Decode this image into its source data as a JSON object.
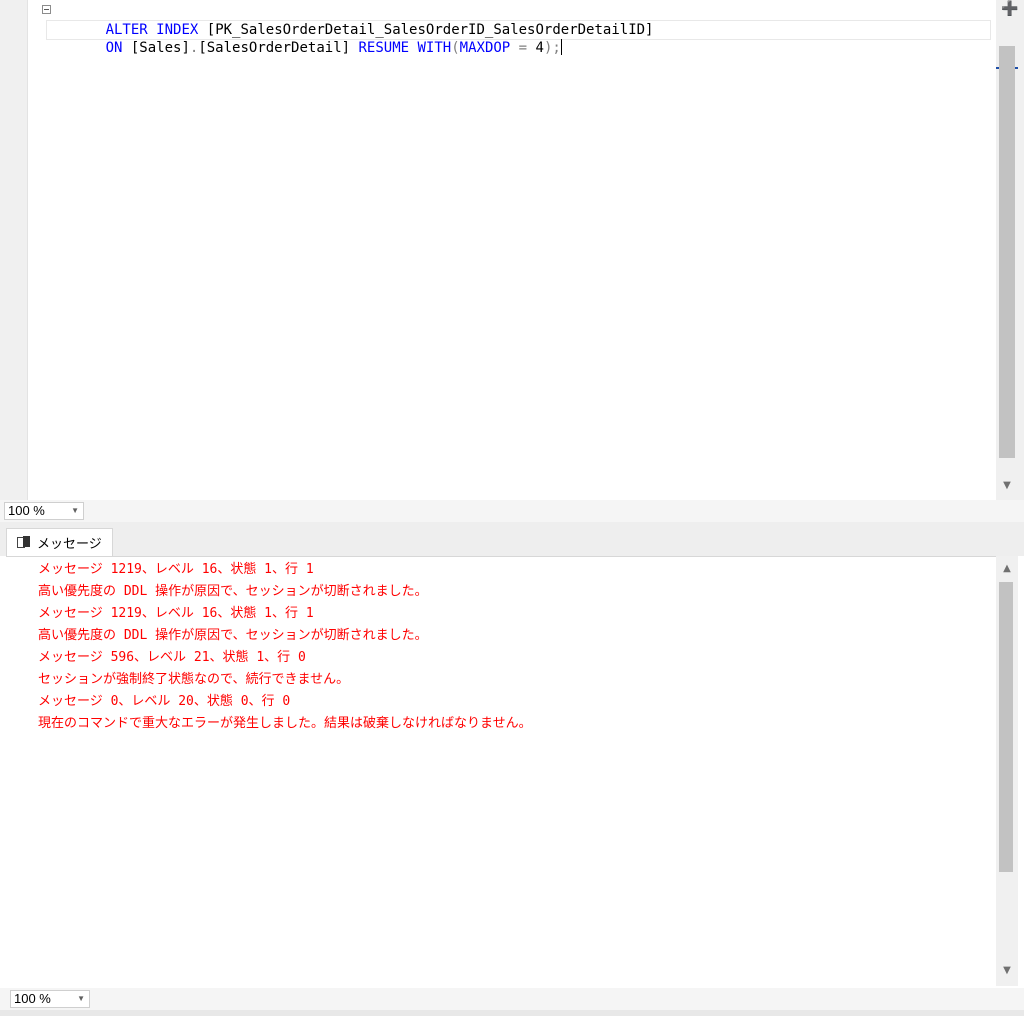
{
  "editor": {
    "lines": [
      [
        {
          "t": "ALTER",
          "c": "kw"
        },
        {
          "t": " ",
          "c": "id"
        },
        {
          "t": "INDEX",
          "c": "kw"
        },
        {
          "t": " ",
          "c": "id"
        },
        {
          "t": "[PK_SalesOrderDetail_SalesOrderID_SalesOrderDetailID]",
          "c": "id"
        }
      ],
      [
        {
          "t": "ON",
          "c": "kw"
        },
        {
          "t": " ",
          "c": "id"
        },
        {
          "t": "[Sales]",
          "c": "id"
        },
        {
          "t": ".",
          "c": "punc"
        },
        {
          "t": "[SalesOrderDetail]",
          "c": "id"
        },
        {
          "t": " ",
          "c": "id"
        },
        {
          "t": "RESUME",
          "c": "kw"
        },
        {
          "t": " ",
          "c": "id"
        },
        {
          "t": "WITH",
          "c": "kw"
        },
        {
          "t": "(",
          "c": "punc"
        },
        {
          "t": "MAXDOP",
          "c": "kw"
        },
        {
          "t": " ",
          "c": "id"
        },
        {
          "t": "=",
          "c": "punc"
        },
        {
          "t": " 4",
          "c": "id"
        },
        {
          "t": ");",
          "c": "punc"
        }
      ]
    ],
    "zoom": "100 %"
  },
  "results": {
    "tab_label": "メッセージ",
    "messages": [
      "メッセージ 1219、レベル 16、状態 1、行 1",
      "高い優先度の DDL 操作が原因で、セッションが切断されました。",
      "メッセージ 1219、レベル 16、状態 1、行 1",
      "高い優先度の DDL 操作が原因で、セッションが切断されました。",
      "メッセージ 596、レベル 21、状態 1、行 0",
      "セッションが強制終了状態なので、続行できません。",
      "メッセージ 0、レベル 20、状態 0、行 0",
      "現在のコマンドで重大なエラーが発生しました。結果は破棄しなければなりません。"
    ],
    "zoom": "100 %",
    "message_color": "#ff0000"
  },
  "icons": {
    "collapse": "collapse-icon",
    "splitter": "splitter-icon",
    "messages_tab": "messages-icon"
  }
}
